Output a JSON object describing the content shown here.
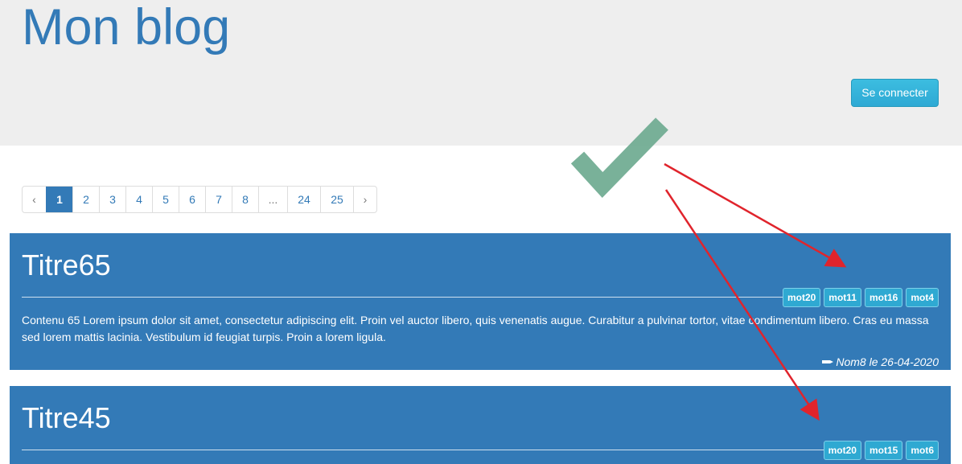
{
  "header": {
    "title": "Mon blog",
    "login_label": "Se connecter"
  },
  "pagination": {
    "prev": "‹",
    "pages": [
      "1",
      "2",
      "3",
      "4",
      "5",
      "6",
      "7",
      "8",
      "...",
      "24",
      "25"
    ],
    "next": "›",
    "current": "1"
  },
  "posts": [
    {
      "title": "Titre65",
      "tags": [
        "mot20",
        "mot11",
        "mot16",
        "mot4"
      ],
      "content": "Contenu 65 Lorem ipsum dolor sit amet, consectetur adipiscing elit. Proin vel auctor libero, quis venenatis augue. Curabitur a pulvinar tortor, vitae condimentum libero. Cras eu massa sed lorem mattis lacinia. Vestibulum id feugiat turpis. Proin a lorem ligula.",
      "footer": "Nom8 le 26-04-2020"
    },
    {
      "title": "Titre45",
      "tags": [
        "mot20",
        "mot15",
        "mot6"
      ]
    }
  ],
  "colors": {
    "primary": "#337ab7",
    "info": "#2fa9d2",
    "checkmark": "#6aa88e",
    "arrow": "#e0242c",
    "header_bg": "#eeeeee"
  },
  "icons": {
    "footer": "pencil-icon",
    "annotation": "checkmark-icon"
  }
}
